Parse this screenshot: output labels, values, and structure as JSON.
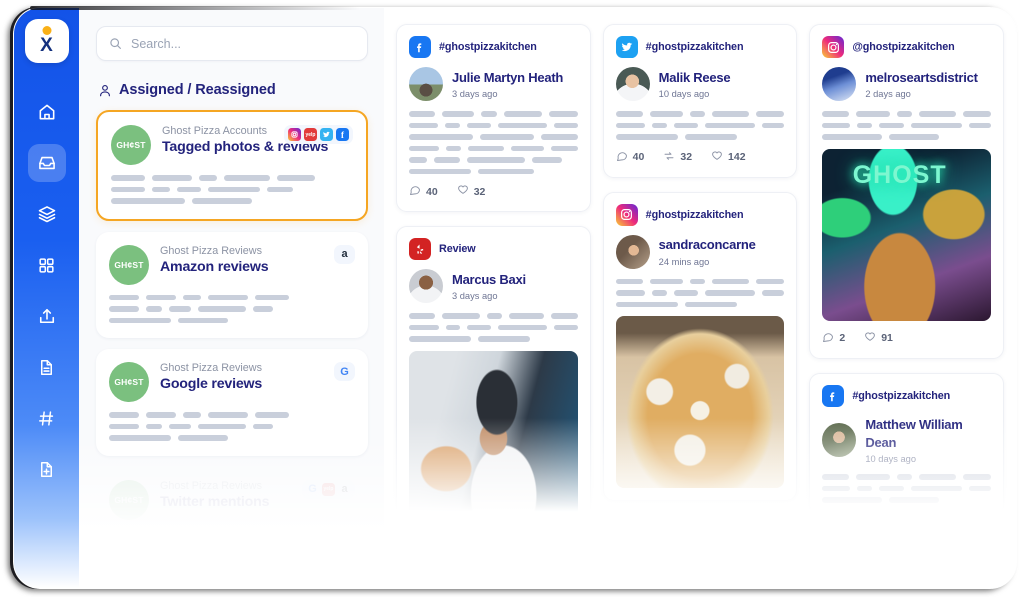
{
  "app": {
    "logo_letter": "X",
    "sidebar_items": [
      {
        "name": "home",
        "icon": "home-icon",
        "active": false
      },
      {
        "name": "inbox",
        "icon": "inbox-icon",
        "active": true
      },
      {
        "name": "layers",
        "icon": "layers-icon",
        "active": false
      },
      {
        "name": "apps",
        "icon": "grid-icon",
        "active": false
      },
      {
        "name": "publish",
        "icon": "upload-icon",
        "active": false
      },
      {
        "name": "reports",
        "icon": "document-icon",
        "active": false
      },
      {
        "name": "tags",
        "icon": "hashtag-icon",
        "active": false
      },
      {
        "name": "new-document",
        "icon": "document-add-icon",
        "active": false
      }
    ]
  },
  "search": {
    "placeholder": "Search..."
  },
  "section": {
    "title": "Assigned / Reassigned",
    "icon": "person-icon"
  },
  "accounts": [
    {
      "subtitle": "Ghost Pizza Accounts",
      "title": "Tagged photos & reviews",
      "avatar_label": "GH¢ST",
      "selected": true,
      "opacity": "full",
      "channels": [
        "instagram",
        "yelp",
        "twitter",
        "facebook"
      ],
      "skeleton": [
        [
          34,
          40,
          18,
          46,
          38
        ],
        [
          34,
          18,
          24,
          52,
          26
        ],
        [
          74,
          60
        ]
      ]
    },
    {
      "subtitle": "Ghost Pizza Reviews",
      "title": "Amazon reviews",
      "avatar_label": "GH¢ST",
      "selected": false,
      "opacity": "full",
      "channels": [
        "amazon"
      ],
      "skeleton": [
        [
          30,
          30,
          18,
          40,
          34
        ],
        [
          30,
          16,
          22,
          48,
          20
        ],
        [
          62,
          50
        ]
      ]
    },
    {
      "subtitle": "Ghost Pizza Reviews",
      "title": "Google reviews",
      "avatar_label": "GH¢ST",
      "selected": false,
      "opacity": "full",
      "channels": [
        "google"
      ],
      "skeleton": [
        [
          30,
          30,
          18,
          40,
          34
        ],
        [
          30,
          16,
          22,
          48,
          20
        ],
        [
          62,
          50
        ]
      ]
    },
    {
      "subtitle": "Ghost Pizza Reviews",
      "title": "Twitter mentions",
      "avatar_label": "GH¢ST",
      "selected": false,
      "opacity": "faded",
      "channels": [
        "google",
        "yelp",
        "amazon"
      ],
      "skeleton": [
        [
          30,
          30,
          18,
          40,
          34
        ],
        [
          30,
          16,
          22,
          48,
          20
        ],
        [
          62,
          50
        ]
      ]
    }
  ],
  "feed": {
    "columns": [
      {
        "posts": [
          {
            "platform": "facebook",
            "platform_icon": "facebook-icon",
            "handle": "#ghostpizzakitchen",
            "author": "Julie Martyn Heath",
            "time": "3 days ago",
            "avatar": "ph-julie",
            "skeleton": [
              [
                36,
                44,
                22,
                52,
                40
              ],
              [
                34,
                18,
                28,
                58,
                28
              ],
              [
                66,
                56,
                38
              ],
              [
                38,
                20,
                46,
                42,
                34
              ],
              [
                18,
                26,
                58,
                30
              ],
              [
                62,
                56
              ]
            ],
            "stats": [
              {
                "icon": "comment-icon",
                "value": "40"
              },
              {
                "icon": "heart-icon",
                "value": "32"
              }
            ],
            "media": null
          },
          {
            "platform": "yelp",
            "platform_icon": "yelp-icon",
            "handle": "Review",
            "author": "Marcus Baxi",
            "time": "3 days ago",
            "avatar": "ph-marcus",
            "skeleton": [
              [
                36,
                52,
                20,
                48,
                36
              ],
              [
                32,
                16,
                26,
                52,
                26
              ],
              [
                62,
                52
              ]
            ],
            "stats": [],
            "media": "img-marcus"
          }
        ]
      },
      {
        "posts": [
          {
            "platform": "twitter",
            "platform_icon": "twitter-icon",
            "handle": "#ghostpizzakitchen",
            "author": "Malik Reese",
            "time": "10 days ago",
            "avatar": "ph-malik",
            "skeleton": [
              [
                36,
                44,
                20,
                50,
                38
              ],
              [
                32,
                16,
                26,
                54,
                24
              ],
              [
                62,
                52
              ]
            ],
            "stats": [
              {
                "icon": "comment-icon",
                "value": "40"
              },
              {
                "icon": "retweet-icon",
                "value": "32"
              },
              {
                "icon": "heart-icon",
                "value": "142"
              }
            ],
            "media": null
          },
          {
            "platform": "instagram",
            "platform_icon": "instagram-icon",
            "handle": "#ghostpizzakitchen",
            "author": "sandraconcarne",
            "time": "24 mins ago",
            "avatar": "ph-sandra",
            "skeleton": [
              [
                36,
                44,
                20,
                50,
                38
              ],
              [
                32,
                16,
                26,
                54,
                24
              ],
              [
                62,
                52
              ]
            ],
            "stats": [],
            "media": "img-pizza"
          }
        ]
      },
      {
        "posts": [
          {
            "platform": "instagram",
            "platform_icon": "instagram-icon",
            "handle": "@ghostpizzakitchen",
            "author": "melroseartsdistrict",
            "time": "2 days ago",
            "avatar": "ph-melrose",
            "skeleton": [
              [
                34,
                44,
                20,
                48,
                36
              ],
              [
                30,
                16,
                26,
                54,
                24
              ],
              [
                60,
                50
              ]
            ],
            "stats": [
              {
                "icon": "comment-icon",
                "value": "2"
              },
              {
                "icon": "heart-icon",
                "value": "91"
              }
            ],
            "media": "img-ghost",
            "media_caption": "GHOST"
          },
          {
            "platform": "facebook",
            "platform_icon": "facebook-icon",
            "handle": "#ghostpizzakitchen",
            "author": "Matthew William Dean",
            "time": "10 days ago",
            "avatar": "ph-matthew",
            "skeleton": [
              [
                34,
                44,
                20,
                48,
                36
              ],
              [
                30,
                16,
                26,
                54,
                24
              ],
              [
                60,
                50
              ]
            ],
            "stats": [],
            "media": null
          }
        ]
      }
    ]
  },
  "colors": {
    "brand_blue": "#1353e8",
    "accent_orange": "#f5a623",
    "navy_text": "#23237c",
    "ghost_green": "#7bc07f",
    "skeleton_grey": "#c9cfdb"
  }
}
